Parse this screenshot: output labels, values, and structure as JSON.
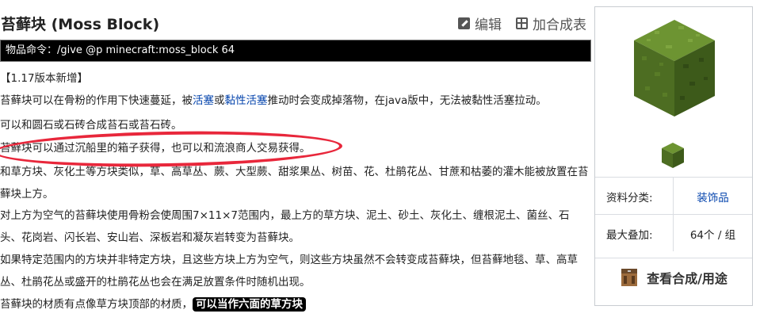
{
  "title": "苔藓块 (Moss Block)",
  "actions": {
    "edit": "编辑",
    "add_recipe_table": "加合成表"
  },
  "command": "物品命令：/give @p minecraft:moss_block 64",
  "version_note": "【1.17版本新增】",
  "para1": {
    "before": "苔藓块可以在骨粉的作用下快速蔓延，被",
    "link1": "活塞",
    "mid": "或",
    "link2": "黏性活塞",
    "after": "推动时会变成掉落物，在java版中，无法被黏性活塞拉动。"
  },
  "para2": "可以和圆石或石砖合成苔石或苔石砖。",
  "para3": "苔藓块可以通过沉船里的箱子获得，也可以和流浪商人交易获得。",
  "para4": "和草方块、灰化土等方块类似，草、高草丛、蕨、大型蕨、甜浆果丛、树苗、花、杜鹃花丛、甘蔗和枯萎的灌木能被放置在苔藓块上方。",
  "para5": "对上方为空气的苔藓块使用骨粉会使周围7×11×7范围内，最上方的草方块、泥土、砂土、灰化土、缠根泥土、菌丝、石头、花岗岩、闪长岩、安山岩、深板岩和凝灰岩转变为苔藓块。",
  "para6": "如果特定范围内的方块并非特定方块，且这些方块上方为空气，则这些方块虽然不会转变成苔藓块，但苔藓地毯、草、高草丛、杜鹃花丛或盛开的杜鹃花丛也会在满足放置条件时随机出现。",
  "para7": {
    "text": "苔藓块的材质有点像草方块顶部的材质，",
    "highlight": "可以当作六面的草方块"
  },
  "sidebar": {
    "category_label": "资料分类:",
    "category_value": "装饰品",
    "stack_label": "最大叠加:",
    "stack_value": "64个 / 组",
    "view_recipe": "查看合成/用途"
  },
  "icons": {
    "edit": "edit-icon",
    "table": "table-icon",
    "crafting": "crafting-table-icon",
    "block": "moss-block-icon"
  },
  "colors": {
    "link": "#0645ad",
    "annotation": "#e8273b",
    "moss": "#5a7d2a"
  }
}
